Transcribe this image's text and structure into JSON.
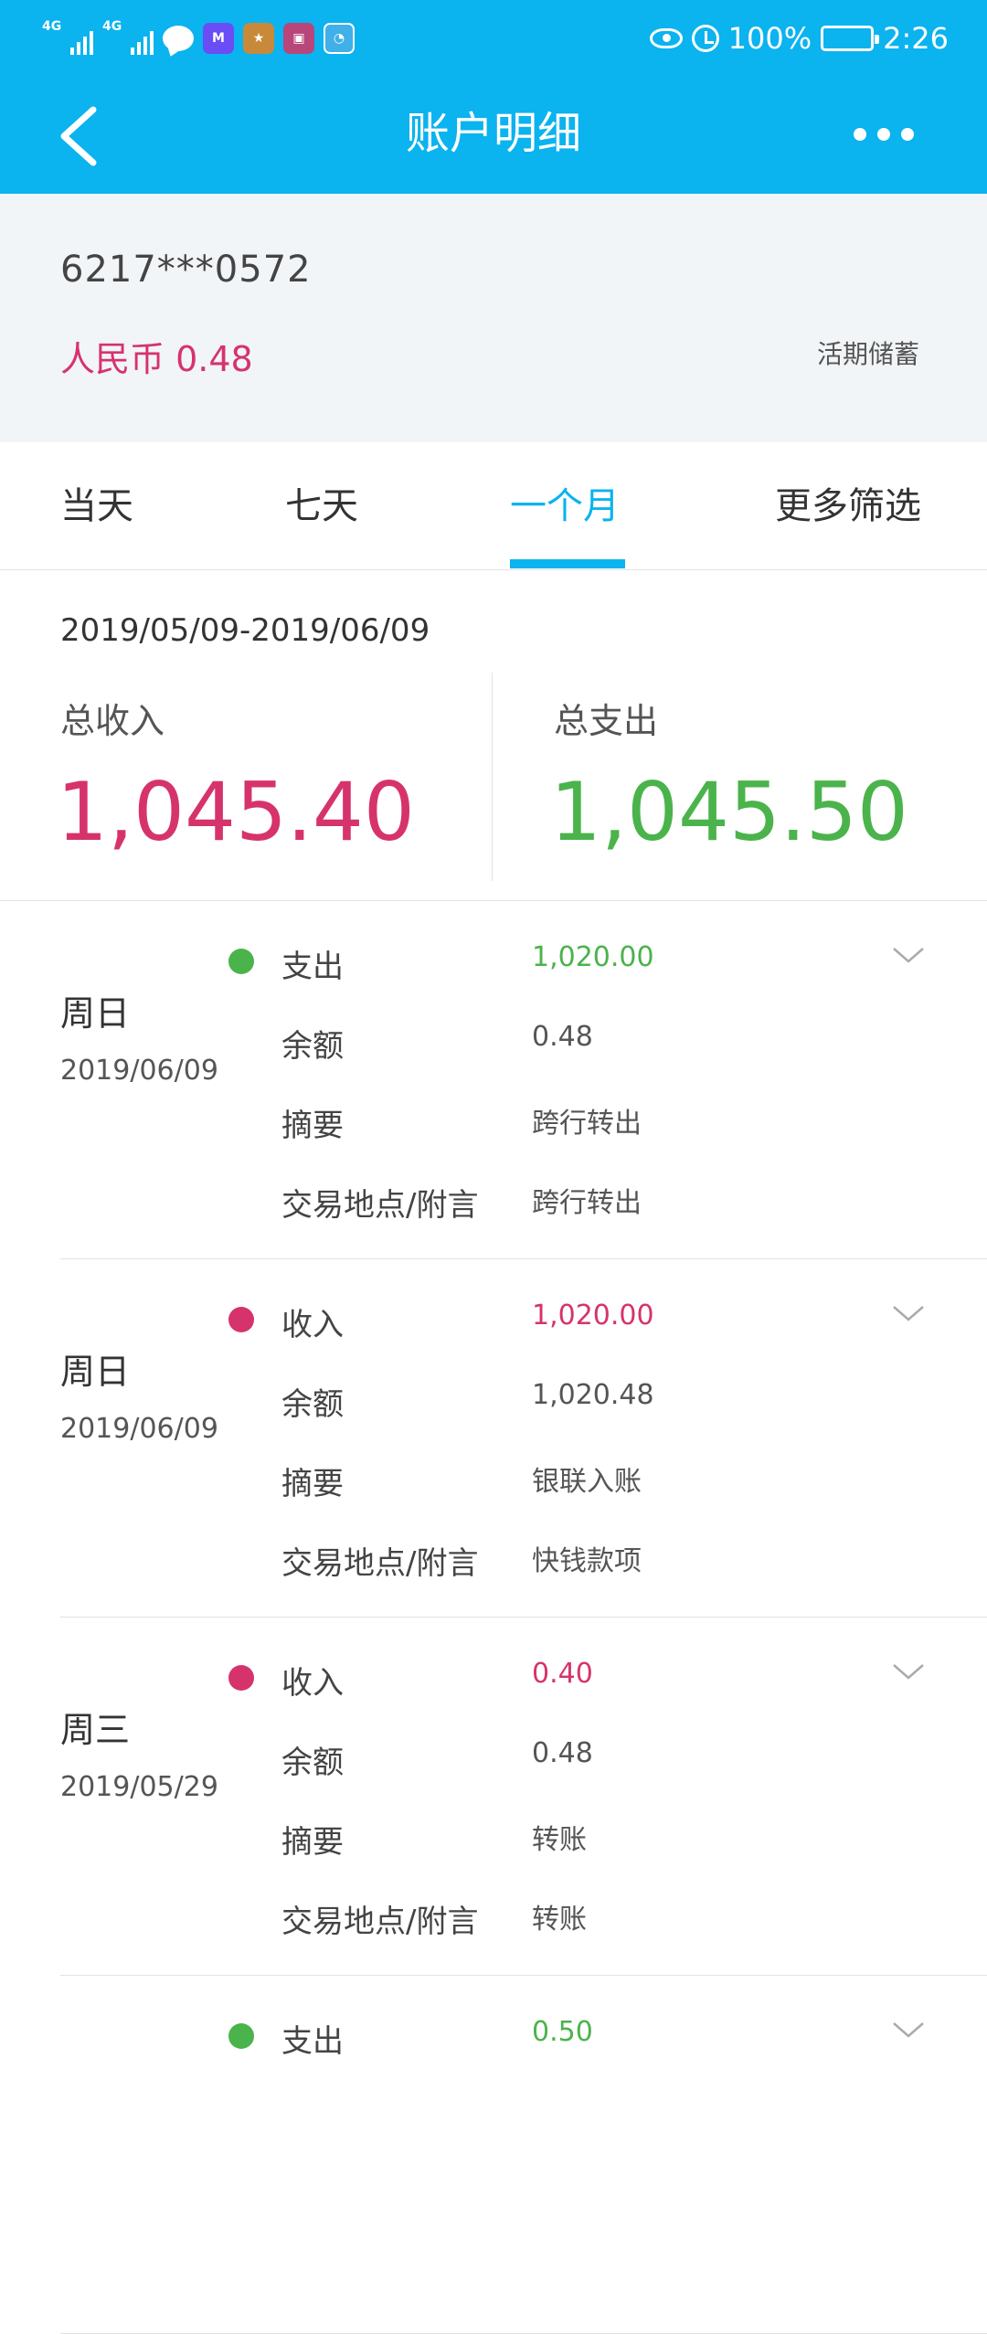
{
  "status_bar": {
    "signal1": "4G",
    "signal2": "4G",
    "battery": "100%",
    "time": "2:26",
    "icons": [
      "message-icon",
      "m-app-icon",
      "game-app-icon",
      "shop-app-icon",
      "assistant-app-icon",
      "eye-icon",
      "alarm-icon",
      "battery-icon"
    ]
  },
  "nav": {
    "title": "账户明细"
  },
  "account": {
    "number": "6217***0572",
    "balance": "人民币 0.48",
    "type": "活期储蓄"
  },
  "tabs": [
    {
      "label": "当天",
      "active": false
    },
    {
      "label": "七天",
      "active": false
    },
    {
      "label": "一个月",
      "active": true
    },
    {
      "label": "更多筛选",
      "active": false
    }
  ],
  "summary": {
    "period": "2019/05/09-2019/06/09",
    "income_label": "总收入",
    "income_value": "1,045.40",
    "expense_label": "总支出",
    "expense_value": "1,045.50"
  },
  "colors": {
    "accent": "#0bb3ef",
    "income": "#d6336c",
    "expense": "#4bb34b"
  },
  "transactions": [
    {
      "weekday": "周日",
      "date": "2019/06/09",
      "kind": "expense",
      "type_label": "支出",
      "amount": "1,020.00",
      "balance_label": "余额",
      "balance": "0.48",
      "summary_label": "摘要",
      "summary": "跨行转出",
      "note_label": "交易地点/附言",
      "note": "跨行转出"
    },
    {
      "weekday": "周日",
      "date": "2019/06/09",
      "kind": "income",
      "type_label": "收入",
      "amount": "1,020.00",
      "balance_label": "余额",
      "balance": "1,020.48",
      "summary_label": "摘要",
      "summary": "银联入账",
      "note_label": "交易地点/附言",
      "note": "快钱款项"
    },
    {
      "weekday": "周三",
      "date": "2019/05/29",
      "kind": "income",
      "type_label": "收入",
      "amount": "0.40",
      "balance_label": "余额",
      "balance": "0.48",
      "summary_label": "摘要",
      "summary": "转账",
      "note_label": "交易地点/附言",
      "note": "转账"
    },
    {
      "weekday": "",
      "date": "",
      "kind": "expense",
      "type_label": "支出",
      "amount": "0.50",
      "balance_label": "",
      "balance": "",
      "summary_label": "",
      "summary": "",
      "note_label": "",
      "note": ""
    }
  ]
}
